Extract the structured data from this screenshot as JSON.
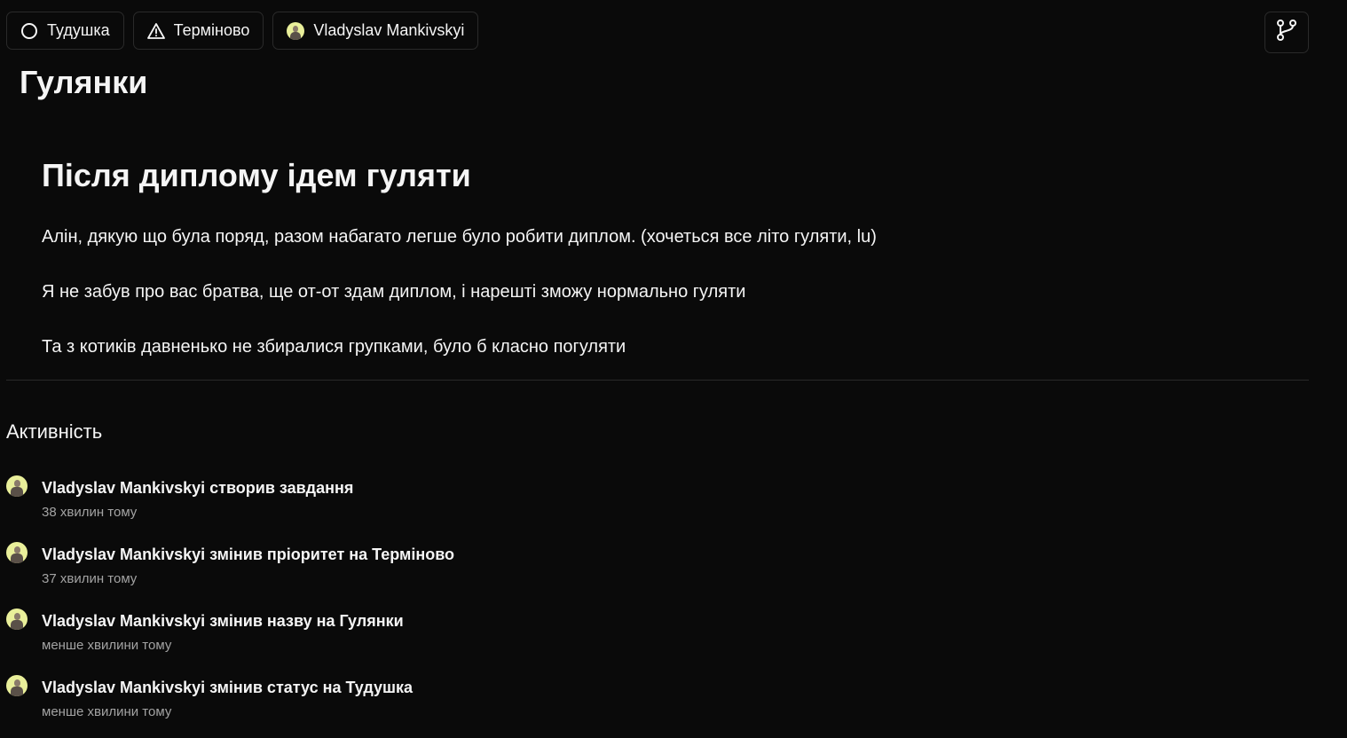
{
  "toolbar": {
    "status_label": "Тудушка",
    "priority_label": "Терміново",
    "assignee_label": "Vladyslav Mankivskyi"
  },
  "page": {
    "title": "Гулянки"
  },
  "task": {
    "heading": "Після диплому ідем гуляти",
    "paragraphs": [
      "Алін, дякую що була поряд, разом набагато легше було робити диплом. (хочеться все літо гуляти, lu)",
      "Я не забув про вас братва, ще от-от здам диплом, і нарешті зможу нормально гуляти",
      "Та з котиків давненько не збиралися групками, було б класно погуляти"
    ]
  },
  "activity": {
    "title": "Активність",
    "items": [
      {
        "text": "Vladyslav Mankivskyi створив завдання",
        "time": "38 хвилин тому"
      },
      {
        "text": "Vladyslav Mankivskyi змінив пріоритет на Терміново",
        "time": "37 хвилин тому"
      },
      {
        "text": "Vladyslav Mankivskyi змінив назву на Гулянки",
        "time": "менше хвилини тому"
      },
      {
        "text": "Vladyslav Mankivskyi змінив статус на Тудушка",
        "time": "менше хвилини тому"
      }
    ]
  },
  "icons": {
    "status": "circle-icon",
    "priority": "warning-triangle-icon",
    "branch": "git-branch-icon"
  },
  "colors": {
    "background": "#0a0a0a",
    "text": "#f5f5f5",
    "muted": "#a3a3a3",
    "border": "#2a2a2a",
    "avatar_bg": "#e9ef9a"
  }
}
